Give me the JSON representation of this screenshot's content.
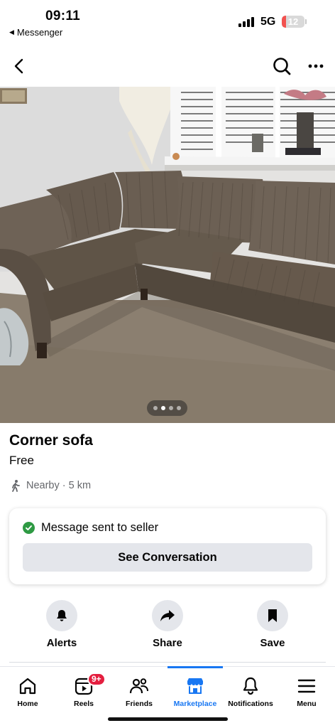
{
  "status_bar": {
    "time": "09:11",
    "back_app": "Messenger",
    "network": "5G",
    "battery": "12",
    "battery_level_percent": 12,
    "battery_color": "#f2524f"
  },
  "nav": {
    "back_icon": "chevron-left-icon",
    "search_icon": "search-icon",
    "more_icon": "more-horizontal-icon"
  },
  "gallery": {
    "photo_count": 4,
    "current_index": 1
  },
  "listing": {
    "title": "Corner sofa",
    "price": "Free",
    "location": "Nearby · 5 km"
  },
  "message_card": {
    "status": "Message sent to seller",
    "button": "See Conversation",
    "status_color": "#2e9a43"
  },
  "actions": [
    {
      "label": "Alerts",
      "icon": "bell-icon"
    },
    {
      "label": "Share",
      "icon": "share-arrow-icon"
    },
    {
      "label": "Save",
      "icon": "bookmark-icon"
    }
  ],
  "tabbar": {
    "accent": "#1877f2",
    "items": [
      {
        "label": "Home",
        "icon": "home-icon"
      },
      {
        "label": "Reels",
        "icon": "reels-icon",
        "badge": "9+"
      },
      {
        "label": "Friends",
        "icon": "friends-icon"
      },
      {
        "label": "Marketplace",
        "icon": "marketplace-icon",
        "active": true
      },
      {
        "label": "Notifications",
        "icon": "bell-icon"
      },
      {
        "label": "Menu",
        "icon": "menu-icon"
      }
    ]
  }
}
